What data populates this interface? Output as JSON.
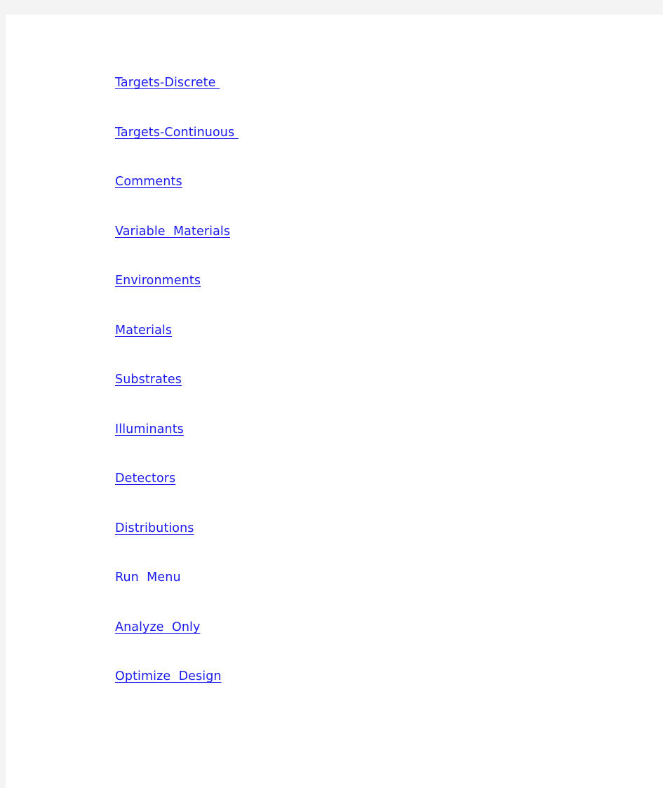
{
  "page": {
    "background_color": "#ffffff",
    "backdrop_color": "#f4f4f5",
    "link_color": "#1a1aee"
  },
  "link_list": {
    "items": [
      {
        "label": "Targets-Discrete ",
        "underlined": true,
        "name": "link-targets-discrete"
      },
      {
        "label": "Targets-Continuous ",
        "underlined": true,
        "name": "link-targets-continuous"
      },
      {
        "label": "Comments",
        "underlined": true,
        "name": "link-comments"
      },
      {
        "label": "Variable  Materials",
        "underlined": true,
        "name": "link-variable-materials"
      },
      {
        "label": "Environments",
        "underlined": true,
        "name": "link-environments"
      },
      {
        "label": "Materials",
        "underlined": true,
        "name": "link-materials"
      },
      {
        "label": "Substrates",
        "underlined": true,
        "name": "link-substrates"
      },
      {
        "label": "Illuminants",
        "underlined": true,
        "name": "link-illuminants"
      },
      {
        "label": "Detectors",
        "underlined": true,
        "name": "link-detectors"
      },
      {
        "label": "Distributions",
        "underlined": true,
        "name": "link-distributions"
      },
      {
        "label": "Run  Menu",
        "underlined": false,
        "name": "link-run-menu"
      },
      {
        "label": "Analyze  Only",
        "underlined": true,
        "name": "link-analyze-only"
      },
      {
        "label": "Optimize  Design",
        "underlined": true,
        "name": "link-optimize-design"
      }
    ]
  }
}
